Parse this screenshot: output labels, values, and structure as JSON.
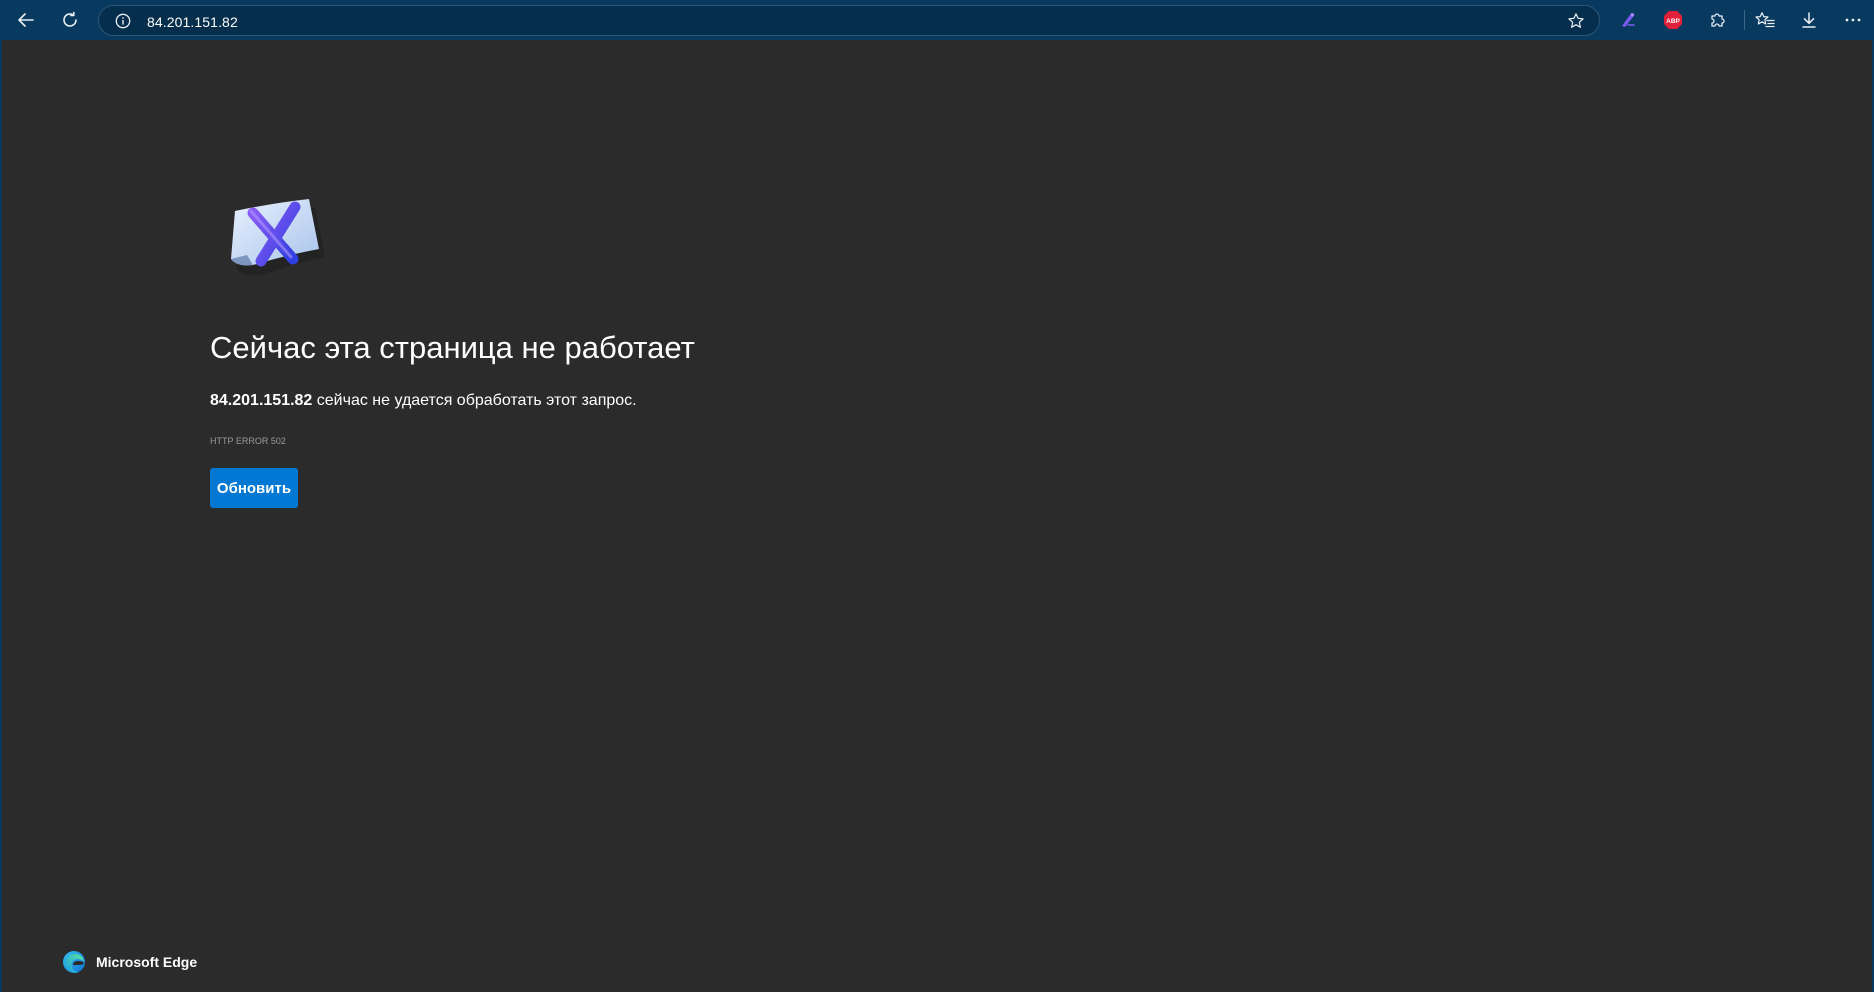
{
  "browser": {
    "name": "Microsoft Edge",
    "address_bar": {
      "url": "84.201.151.82"
    },
    "toolbar_icons": [
      "back-arrow-icon",
      "refresh-icon",
      "site-info-icon",
      "favorite-star-icon",
      "extension-pen-icon",
      "adblock-plus-icon",
      "extensions-puzzle-icon",
      "favorites-icon",
      "downloads-icon",
      "more-options-icon"
    ],
    "adblock_badge": "ABP"
  },
  "error_page": {
    "title": "Сейчас эта страница не работает",
    "description_host": "84.201.151.82",
    "description_rest": " сейчас не удается обработать этот запрос.",
    "error_code": "HTTP ERROR 502",
    "reload_label": "Обновить"
  },
  "footer": {
    "brand_label": "Microsoft Edge"
  },
  "colors": {
    "toolbar": "#073a5e",
    "page_background": "#2b2b2b",
    "button": "#0078d4"
  }
}
